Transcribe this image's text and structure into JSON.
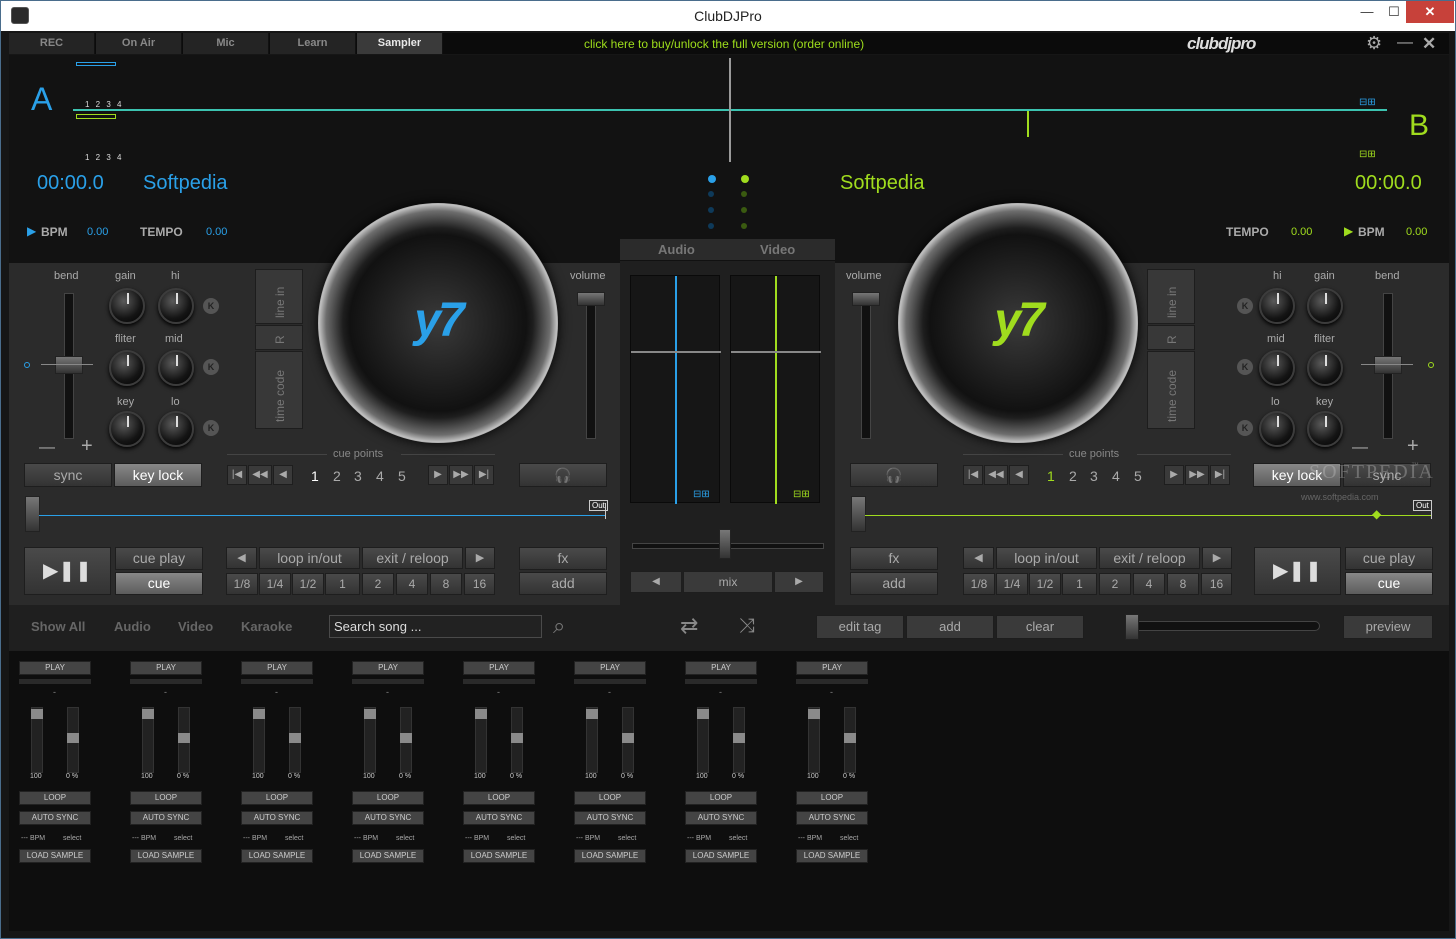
{
  "window": {
    "title": "ClubDJPro",
    "min": "—",
    "max": "☐",
    "close": "✕"
  },
  "tabs": [
    "REC",
    "On Air",
    "Mic",
    "Learn",
    "Sampler"
  ],
  "promo": "click here to buy/unlock the full version (order online)",
  "brand": "clubdjpro",
  "toolbar": {
    "gear": "⚙",
    "min": "—",
    "close": "✕"
  },
  "deckA": {
    "letter": "A",
    "beats": "1 2 3 4",
    "time": "00:00.0",
    "title": "Softpedia",
    "bpm_label": "BPM",
    "bpm": "0.00",
    "tempo_label": "TEMPO",
    "tempo": "0.00"
  },
  "deckB": {
    "letter": "B",
    "time": "00:00.0",
    "title": "Softpedia",
    "bpm_label": "BPM",
    "bpm": "0.00",
    "tempo_label": "TEMPO",
    "tempo": "0.00"
  },
  "labels": {
    "bend": "bend",
    "gain": "gain",
    "hi": "hi",
    "filter": "fliter",
    "mid": "mid",
    "key": "key",
    "lo": "lo",
    "volume": "volume",
    "k": "K",
    "minus": "—",
    "plus": "+",
    "line_in": "line in",
    "r": "R",
    "time_code": "time code",
    "cue_points": "cue points",
    "play": "▶❚❚",
    "out": "Out",
    "watermark": "SOFTPEDIA",
    "watermark_url": "www.softpedia.com",
    "softpedia_r": "™"
  },
  "buttons": {
    "sync": "sync",
    "key_lock": "key lock",
    "cue_play": "cue play",
    "cue": "cue",
    "loop": "loop in/out",
    "exit": "exit / reloop",
    "fx": "fx",
    "add": "add"
  },
  "cue_nums": [
    "1",
    "2",
    "3",
    "4",
    "5"
  ],
  "loop_sizes": [
    "1/8",
    "1/4",
    "1/2",
    "1",
    "2",
    "4",
    "8",
    "16"
  ],
  "mixer": {
    "audio": "Audio",
    "video": "Video",
    "mix": "mix",
    "left": "◀",
    "right": "▶"
  },
  "lib": {
    "tabs": [
      "Show All",
      "Audio",
      "Video",
      "Karaoke"
    ],
    "search": "Search song ...",
    "edit_tag": "edit tag",
    "add": "add",
    "clear": "clear",
    "preview": "preview"
  },
  "sampler": {
    "play": "PLAY",
    "dash": "-",
    "vol": "100",
    "pitch": "0 %",
    "loop": "LOOP",
    "auto_sync": "AUTO SYNC",
    "bpm": "--- BPM",
    "select": "select",
    "load": "LOAD SAMPLE"
  },
  "colors": {
    "deckA": "#2aa0e8",
    "deckB": "#a0dc1e"
  }
}
